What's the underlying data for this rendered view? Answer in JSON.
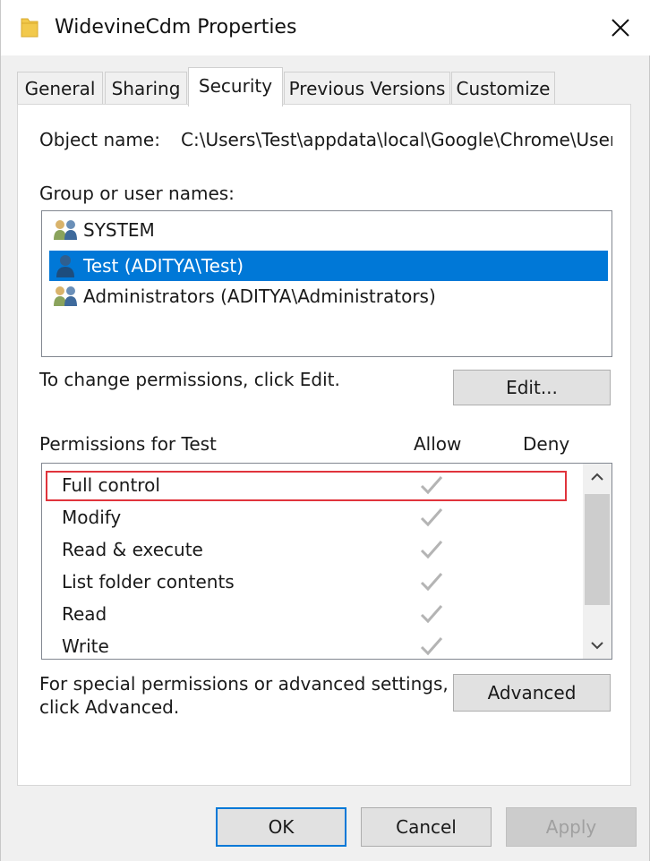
{
  "window": {
    "title": "WidevineCdm Properties",
    "icon": "folder-icon",
    "close_icon": "close-icon"
  },
  "tabs": [
    {
      "label": "General",
      "active": false
    },
    {
      "label": "Sharing",
      "active": false
    },
    {
      "label": "Security",
      "active": true
    },
    {
      "label": "Previous Versions",
      "active": false
    },
    {
      "label": "Customize",
      "active": false
    }
  ],
  "security": {
    "object_name_label": "Object name:",
    "object_name_value": "C:\\Users\\Test\\appdata\\local\\Google\\Chrome\\User Data\\WidevineCdm",
    "group_label": "Group or user names:",
    "users": [
      {
        "name": "SYSTEM",
        "icon": "users-group-icon",
        "selected": false
      },
      {
        "name": "Test (ADITYA\\Test)",
        "icon": "user-icon",
        "selected": true
      },
      {
        "name": "Administrators (ADITYA\\Administrators)",
        "icon": "users-group-icon",
        "selected": false
      }
    ],
    "change_text": "To change permissions, click Edit.",
    "edit_button": "Edit...",
    "permissions_label": "Permissions for Test",
    "allow_header": "Allow",
    "deny_header": "Deny",
    "permissions": [
      {
        "name": "Full control",
        "allow": true,
        "deny": false,
        "highlighted": true
      },
      {
        "name": "Modify",
        "allow": true,
        "deny": false
      },
      {
        "name": "Read & execute",
        "allow": true,
        "deny": false
      },
      {
        "name": "List folder contents",
        "allow": true,
        "deny": false
      },
      {
        "name": "Read",
        "allow": true,
        "deny": false
      },
      {
        "name": "Write",
        "allow": true,
        "deny": false
      }
    ],
    "advanced_text_line1": "For special permissions or advanced settings,",
    "advanced_text_line2": "click Advanced.",
    "advanced_button": "Advanced"
  },
  "footer": {
    "ok": "OK",
    "cancel": "Cancel",
    "apply": "Apply"
  },
  "colors": {
    "selection": "#0078d7",
    "highlight_border": "#e0343c",
    "checkmark_grey": "#b4b4b4"
  }
}
